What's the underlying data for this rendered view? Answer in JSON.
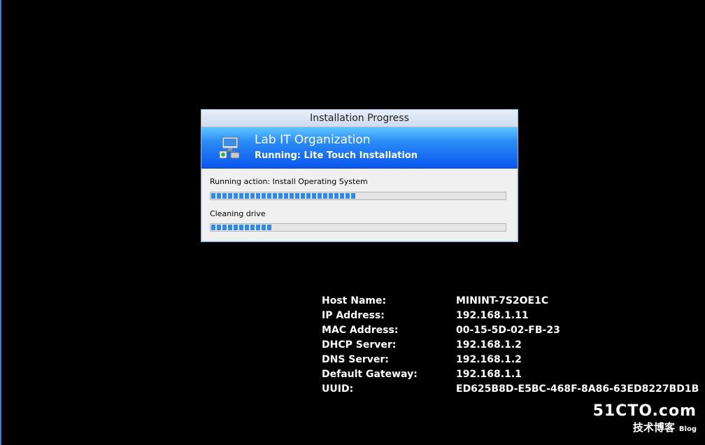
{
  "dialog": {
    "title": "Installation Progress",
    "organization": "Lab IT Organization",
    "running": "Running: Lite Touch Installation",
    "icon": "computer-install-icon",
    "actions": [
      {
        "label": "Running action: Install Operating System",
        "progress_percent": 49
      },
      {
        "label": "Cleaning drive",
        "progress_percent": 21
      }
    ]
  },
  "host_info": [
    {
      "key": "Host Name:",
      "value": "MININT-7S2OE1C"
    },
    {
      "key": "IP Address:",
      "value": "192.168.1.11"
    },
    {
      "key": "MAC Address:",
      "value": "00-15-5D-02-FB-23"
    },
    {
      "key": "DHCP Server:",
      "value": "192.168.1.2"
    },
    {
      "key": "DNS Server:",
      "value": "192.168.1.2"
    },
    {
      "key": "Default Gateway:",
      "value": "192.168.1.1"
    },
    {
      "key": "UUID:",
      "value": "ED625B8D-E5BC-468F-8A86-63ED8227BD1B"
    }
  ],
  "watermark": {
    "site": "51CTO.com",
    "sub": "技术博客",
    "blog": "Blog"
  },
  "colors": {
    "background": "#000000",
    "banner_top": "#5fc6ff",
    "banner_bottom": "#0a56ee",
    "progress_fill": "#2f8be6"
  }
}
